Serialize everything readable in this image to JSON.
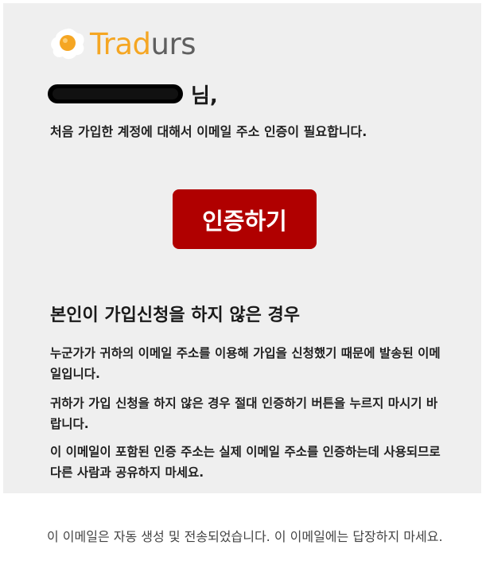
{
  "logo": {
    "brand_part1": "Trad",
    "brand_part2": "urs",
    "icon": "fried-egg-icon",
    "colors": {
      "accent": "#f5a623",
      "gray": "#5f5f5f"
    }
  },
  "greeting": {
    "suffix": "님,"
  },
  "intro": "처음 가입한 계정에 대해서 이메일 주소 인증이 필요합니다.",
  "verify_button": {
    "label": "인증하기",
    "color": "#b00000"
  },
  "section": {
    "title": "본인이 가입신청을 하지 않은 경우",
    "paragraphs": [
      "누군가가 귀하의 이메일 주소를 이용해 가입을 신청했기 때문에 발송된 이메일입니다.",
      "귀하가 가입 신청을 하지 않은 경우 절대 인증하기 버튼을 누르지 마시기 바랍니다.",
      "이 이메일이 포함된 인증 주소는 실제 이메일 주소를 인증하는데 사용되므로 다른 사람과 공유하지 마세요."
    ]
  },
  "footer": "이 이메일은 자동 생성 및 전송되었습니다. 이 이메일에는 답장하지 마세요."
}
